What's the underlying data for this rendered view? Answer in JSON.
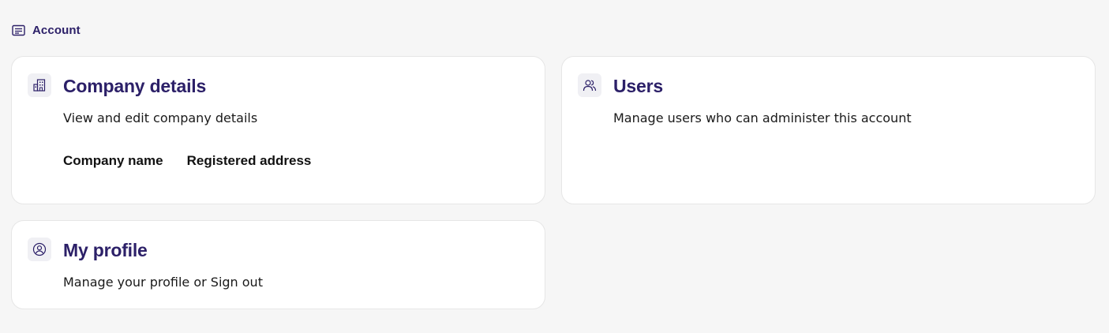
{
  "section": {
    "title": "Account",
    "icon": "list-card-icon"
  },
  "cards": {
    "company": {
      "title": "Company details",
      "description": "View and edit company details",
      "icon": "building-icon",
      "fields": {
        "company_name_label": "Company name",
        "registered_address_label": "Registered address"
      }
    },
    "users": {
      "title": "Users",
      "description": "Manage users who can administer this account",
      "icon": "users-icon"
    },
    "profile": {
      "title": "My profile",
      "description": "Manage your profile or Sign out",
      "icon": "user-circle-icon"
    }
  },
  "colors": {
    "accent": "#2c2068",
    "background": "#f6f6f6",
    "card": "#ffffff",
    "icon_bg": "#f0f0f4"
  }
}
